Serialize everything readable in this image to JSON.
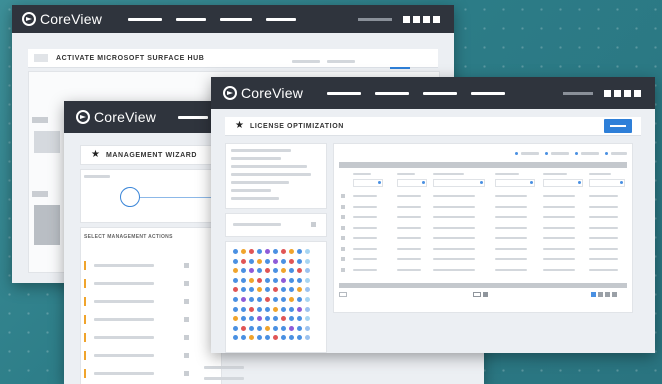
{
  "brand": {
    "logo_text": "CoreView",
    "accent_color": "#2e7fd8",
    "topbar_color": "#2f343d",
    "warning_color": "#f0a42c"
  },
  "windows": {
    "back": {
      "title": "ACTIVATE MICROSOFT SURFACE HUB"
    },
    "middle": {
      "title": "MANAGEMENT WIZARD",
      "section_label": "SELECT MANAGEMENT ACTIONS"
    },
    "front": {
      "title": "LICENSE OPTIMIZATION"
    }
  },
  "icons": {
    "logo": "coreview-logo-icon",
    "star": "star-icon"
  },
  "dot_matrix": {
    "colors": [
      "#4a90e2",
      "#f0a42c",
      "#e05555",
      "#8e5bd8",
      "#5fb3e8"
    ]
  }
}
